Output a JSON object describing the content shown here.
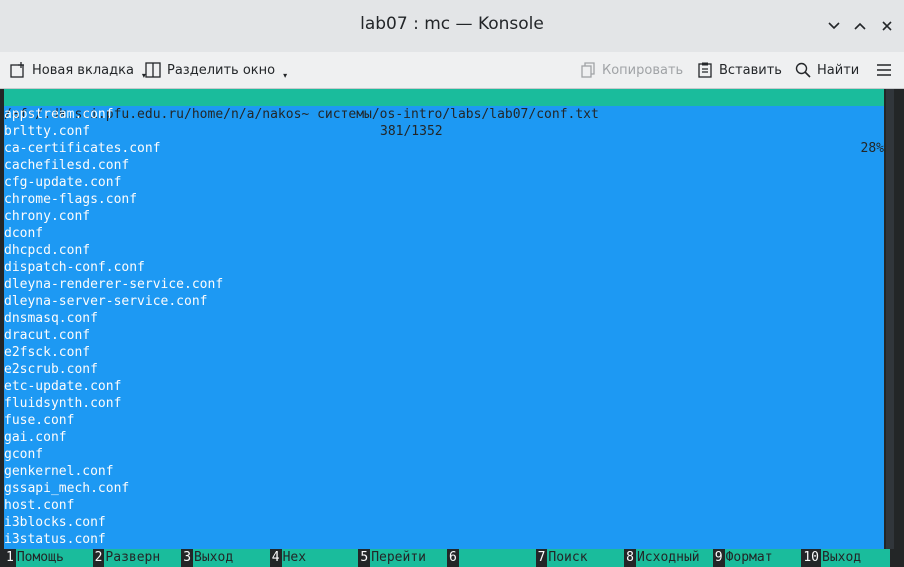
{
  "window": {
    "title": "lab07 : mc — Konsole"
  },
  "toolbar": {
    "new_tab": "Новая вкладка",
    "split_view": "Разделить окно",
    "copy": "Копировать",
    "paste": "Вставить",
    "find": "Найти"
  },
  "viewer": {
    "path": "/afs/.dk.sci.pfu.edu.ru/home/n/a/nakos~ системы/os-intro/labs/lab07/conf.txt",
    "position": "381/1352",
    "percent": "28%",
    "lines": [
      "appstream.conf",
      "brltty.conf",
      "ca-certificates.conf",
      "cachefilesd.conf",
      "cfg-update.conf",
      "chrome-flags.conf",
      "chrony.conf",
      "dconf",
      "dhcpcd.conf",
      "dispatch-conf.conf",
      "dleyna-renderer-service.conf",
      "dleyna-server-service.conf",
      "dnsmasq.conf",
      "dracut.conf",
      "e2fsck.conf",
      "e2scrub.conf",
      "etc-update.conf",
      "fluidsynth.conf",
      "fuse.conf",
      "gai.conf",
      "gconf",
      "genkernel.conf",
      "gssapi_mech.conf",
      "host.conf",
      "i3blocks.conf",
      "i3status.conf"
    ]
  },
  "fkeys": [
    {
      "num": "1",
      "label": "Помощь"
    },
    {
      "num": "2",
      "label": "Разверн"
    },
    {
      "num": "3",
      "label": "Выход"
    },
    {
      "num": "4",
      "label": "Hex"
    },
    {
      "num": "5",
      "label": "Перейти"
    },
    {
      "num": "6",
      "label": ""
    },
    {
      "num": "7",
      "label": "Поиск"
    },
    {
      "num": "8",
      "label": "Исходный"
    },
    {
      "num": "9",
      "label": "Формат"
    },
    {
      "num": "10",
      "label": "Выход"
    }
  ],
  "colors": {
    "selection": "#1d99f3",
    "status": "#1abc9c",
    "terminal_bg": "#232627"
  }
}
